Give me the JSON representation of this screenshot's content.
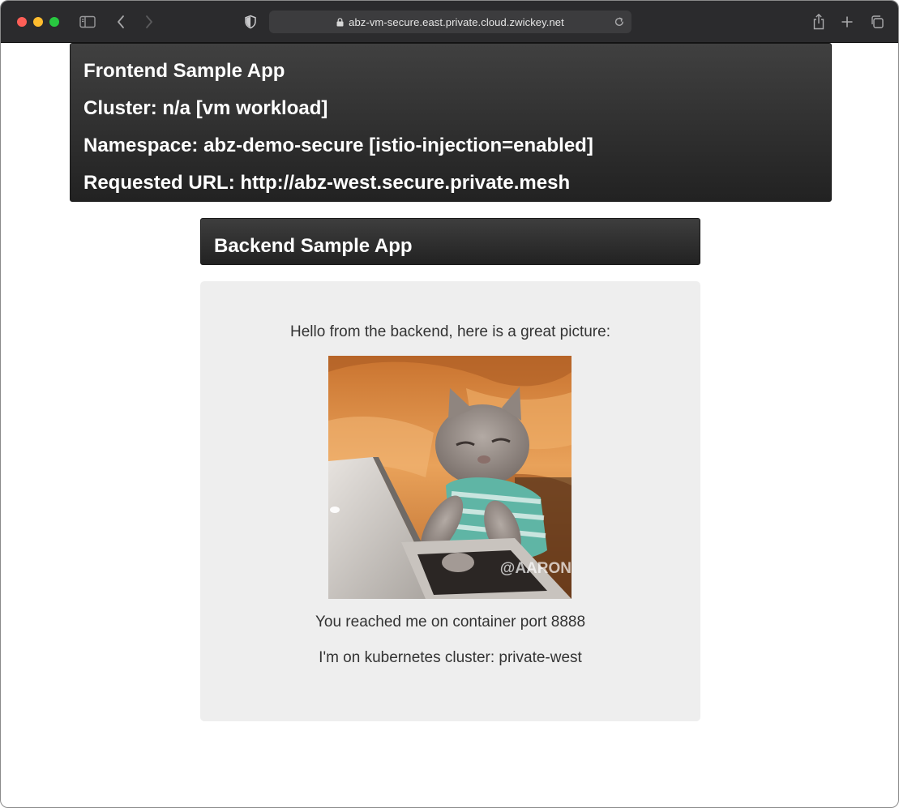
{
  "browser": {
    "url": "abz-vm-secure.east.private.cloud.zwickey.net",
    "icons": [
      "sidebar-icon",
      "back-icon",
      "forward-icon",
      "privacy-shield-icon",
      "lock-icon",
      "reload-icon",
      "share-icon",
      "new-tab-icon",
      "tab-overview-icon"
    ]
  },
  "frontend": {
    "title": "Frontend Sample App",
    "cluster": "Cluster: n/a [vm workload]",
    "namespace": "Namespace: abz-demo-secure [istio-injection=enabled]",
    "requested_url": "Requested URL: http://abz-west.secure.private.mesh"
  },
  "backend": {
    "title": "Backend Sample App",
    "greeting": "Hello from the backend, here is a great picture:",
    "picture_watermark": "@AARON",
    "port_text": "You reached me on container port 8888",
    "cluster_text": "I'm on kubernetes cluster: private-west"
  },
  "colors": {
    "header_bg": "#2b2b2b",
    "panel_bg": "#eeeeee",
    "body_text": "#333333"
  }
}
